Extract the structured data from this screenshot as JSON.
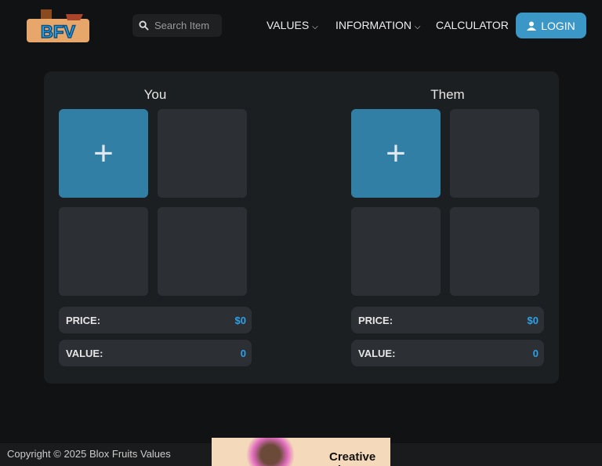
{
  "nav": {
    "logo": "BFV",
    "search_placeholder": "Search Item",
    "values": "VALUES",
    "information": "INFORMATION",
    "calculator": "CALCULATOR",
    "login": "LOGIN"
  },
  "trade": {
    "you": {
      "title": "You",
      "price_label": "PRICE:",
      "price": "$0",
      "value_label": "VALUE:",
      "value": "0"
    },
    "them": {
      "title": "Them",
      "price_label": "PRICE:",
      "price": "$0",
      "value_label": "VALUE:",
      "value": "0"
    }
  },
  "add_symbol": "+",
  "footer": {
    "copyright": "Copyright © 2025 Blox Fruits Values"
  },
  "ad": {
    "text": "Creative Cl"
  }
}
